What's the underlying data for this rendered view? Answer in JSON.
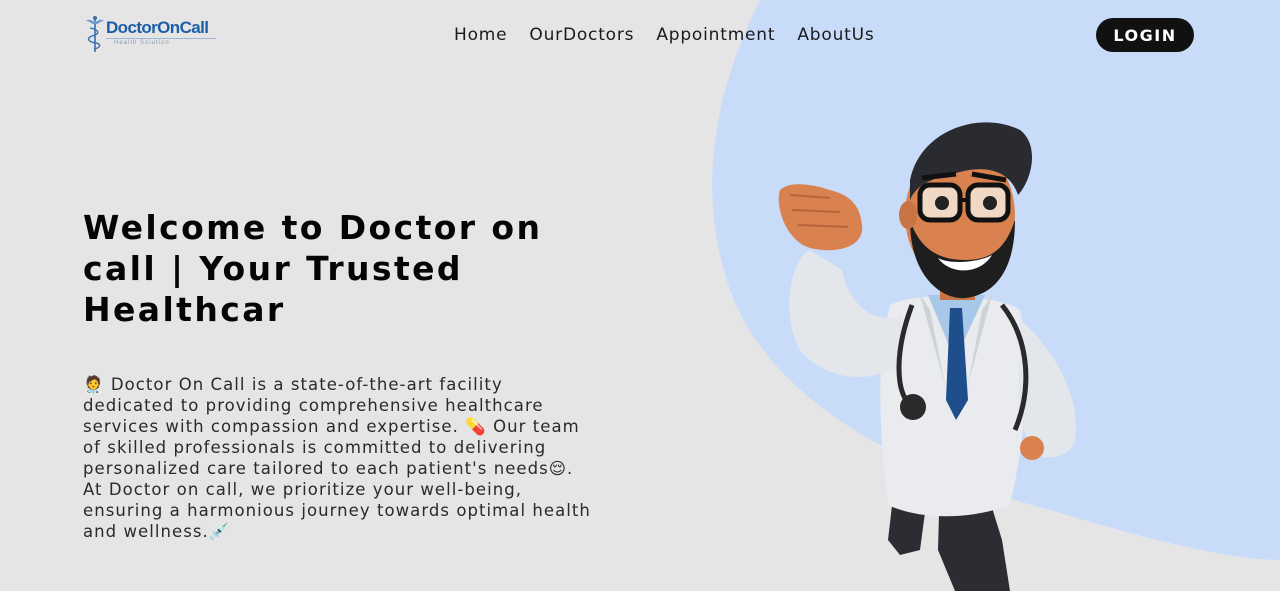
{
  "brand": {
    "name": "DoctorOnCall",
    "tagline": "Health Solution"
  },
  "nav": {
    "items": [
      {
        "label": "Home"
      },
      {
        "label": "OurDoctors"
      },
      {
        "label": "Appointment"
      },
      {
        "label": "AboutUs"
      }
    ],
    "login_label": "LOGIN"
  },
  "hero": {
    "title": "Welcome to Doctor on call | Your Trusted Healthcar",
    "description": "🧑‍⚕️ Doctor On Call is a state-of-the-art facility dedicated to providing comprehensive healthcare services with compassion and expertise. 💊 Our team of skilled professionals is committed to delivering personalized care tailored to each patient's needs😌. At Doctor on call, we prioritize your well-being, ensuring a harmonious journey towards optimal health and wellness.💉"
  },
  "colors": {
    "background": "#e5e5e5",
    "accent_blob": "#c8dcfa",
    "brand_blue": "#1c5fa7",
    "button_bg": "#111111"
  },
  "illustration": "cartoon-doctor"
}
